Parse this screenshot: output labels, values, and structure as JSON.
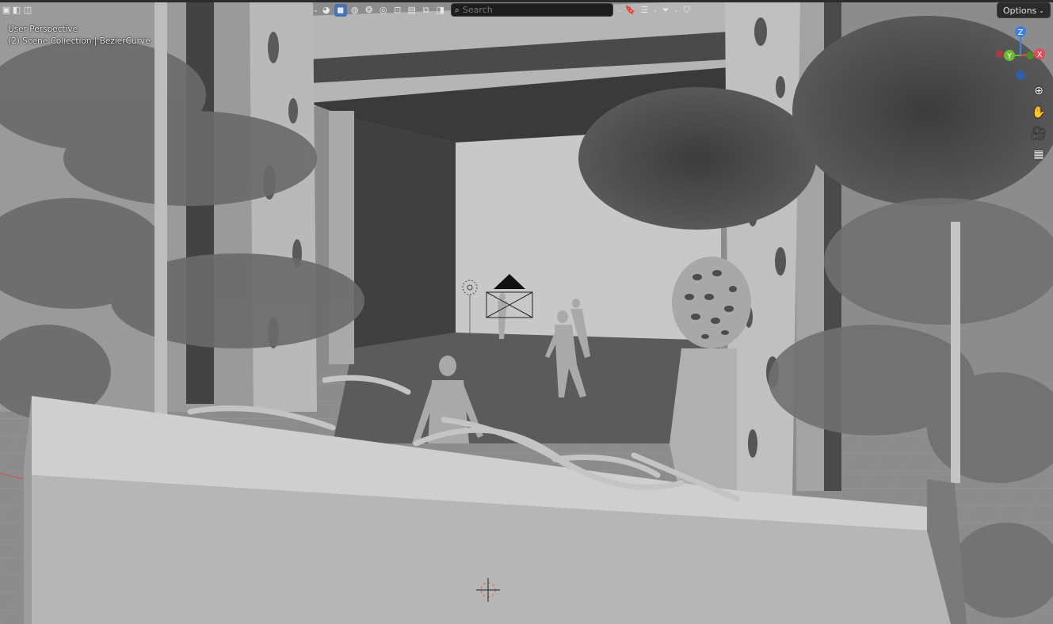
{
  "viewport": {
    "perspective_label": "User Perspective",
    "collection_label": "(2) Scene Collection | BezierCurve"
  },
  "header": {
    "search_placeholder": "Search",
    "options_label": "Options"
  },
  "gizmo": {
    "z_label": "Z",
    "x_label": "X",
    "y_label": "Y",
    "colors": {
      "x": "#e44b5a",
      "y": "#6cbb2f",
      "z": "#3d80e3"
    }
  },
  "nav_icons": [
    "zoom-icon",
    "pan-hand-icon",
    "camera-view-icon",
    "ortho-grid-icon"
  ],
  "colors": {
    "accent": "#4772b3",
    "header_bg": "#2b2b2b"
  }
}
